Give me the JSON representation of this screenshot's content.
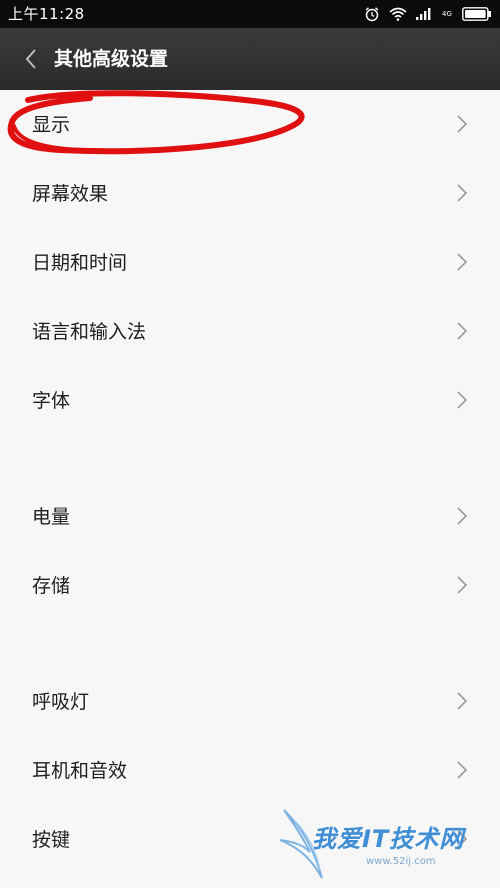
{
  "status_bar": {
    "time": "上午11:28",
    "network_label": "4G",
    "icons": [
      "alarm-icon",
      "wifi-icon",
      "signal-icon",
      "battery-icon"
    ]
  },
  "header": {
    "back_icon": "chevron-left-icon",
    "title": "其他高级设置"
  },
  "settings": {
    "items": [
      {
        "label": "显示"
      },
      {
        "label": "屏幕效果"
      },
      {
        "label": "日期和时间"
      },
      {
        "label": "语言和输入法"
      },
      {
        "label": "字体"
      },
      {
        "label": "电量"
      },
      {
        "label": "存储"
      },
      {
        "label": "呼吸灯"
      },
      {
        "label": "耳机和音效"
      },
      {
        "label": "按键"
      }
    ]
  },
  "annotation": {
    "color": "#e01010",
    "shape": "red-circle-around-first-item"
  },
  "watermark": {
    "title": "我爱IT技术网",
    "subtitle": "www.52ij.com",
    "color": "#3f8ed6"
  },
  "colors": {
    "status_bar": "#0b0b0b",
    "header": "#333333",
    "background": "#f7f7f7",
    "text": "#1e1e1e",
    "chevron": "#9a9a9a"
  }
}
